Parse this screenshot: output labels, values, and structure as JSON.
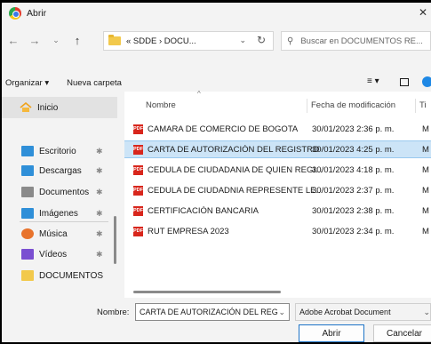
{
  "window": {
    "title": "Abrir"
  },
  "address": {
    "path": "« SDDE › DOCU...",
    "search_placeholder": "Buscar en DOCUMENTOS RE..."
  },
  "toolbar": {
    "organize": "Organizar ▾",
    "new_folder": "Nueva carpeta"
  },
  "sidebar": {
    "home": "Inicio",
    "items": [
      {
        "label": "Escritorio",
        "icon": "desktop-icon",
        "color": "#2f8fd8"
      },
      {
        "label": "Descargas",
        "icon": "download-icon",
        "color": "#2f8fd8"
      },
      {
        "label": "Documentos",
        "icon": "document-icon",
        "color": "#8a8a8a"
      },
      {
        "label": "Imágenes",
        "icon": "picture-icon",
        "color": "#2f8fd8"
      },
      {
        "label": "Música",
        "icon": "music-icon",
        "color": "#e8732c"
      },
      {
        "label": "Vídeos",
        "icon": "video-icon",
        "color": "#7a4fd1"
      },
      {
        "label": "DOCUMENTOS",
        "icon": "folder-icon",
        "color": "#f2c94c"
      }
    ]
  },
  "columns": {
    "name": "Nombre",
    "date": "Fecha de modificación",
    "type": "Ti"
  },
  "files": [
    {
      "name": "CAMARA DE COMERCIO DE BOGOTA",
      "date": "30/01/2023 2:36 p. m.",
      "type": "M",
      "selected": false
    },
    {
      "name": "CARTA DE AUTORIZACIÓN DEL REGISTRO",
      "date": "30/01/2023 4:25 p. m.",
      "type": "M",
      "selected": true
    },
    {
      "name": "CEDULA DE CIUDADANIA DE QUIEN REGI...",
      "date": "30/01/2023 4:18 p. m.",
      "type": "M",
      "selected": false
    },
    {
      "name": "CEDULA DE CIUDADNIA REPRESENTE LE...",
      "date": "30/01/2023 2:37 p. m.",
      "type": "M",
      "selected": false
    },
    {
      "name": "CERTIFICACIÓN BANCARIA",
      "date": "30/01/2023 2:38 p. m.",
      "type": "M",
      "selected": false
    },
    {
      "name": "RUT EMPRESA 2023",
      "date": "30/01/2023 2:34 p. m.",
      "type": "M",
      "selected": false
    }
  ],
  "bottom": {
    "name_label": "Nombre:",
    "name_value": "CARTA DE AUTORIZACIÓN DEL REG",
    "type_value": "Adobe Acrobat Document",
    "open": "Abrir",
    "cancel": "Cancelar"
  },
  "colors": {
    "accent": "#1e74c7",
    "selection": "#cce4f7",
    "pdf": "#d8261c"
  }
}
